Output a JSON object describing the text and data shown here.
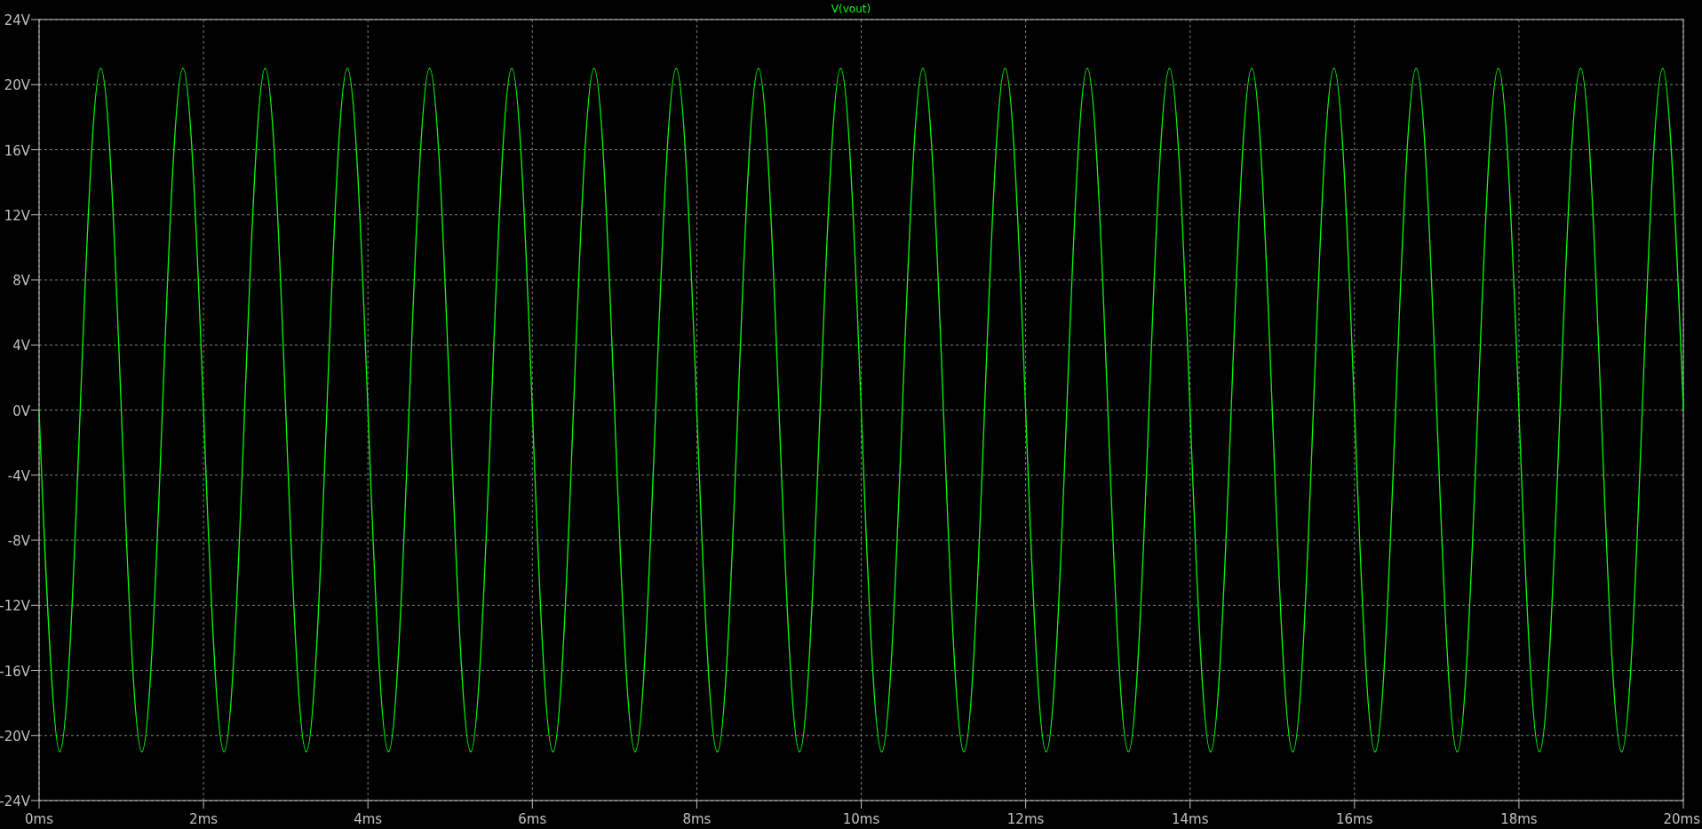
{
  "chart_data": {
    "type": "line",
    "grid": true,
    "xlim": [
      0,
      20
    ],
    "ylim": [
      -24,
      24
    ],
    "xticks": [
      {
        "value": 0,
        "label": "0ms"
      },
      {
        "value": 2,
        "label": "2ms"
      },
      {
        "value": 4,
        "label": "4ms"
      },
      {
        "value": 6,
        "label": "6ms"
      },
      {
        "value": 8,
        "label": "8ms"
      },
      {
        "value": 10,
        "label": "10ms"
      },
      {
        "value": 12,
        "label": "12ms"
      },
      {
        "value": 14,
        "label": "14ms"
      },
      {
        "value": 16,
        "label": "16ms"
      },
      {
        "value": 18,
        "label": "18ms"
      },
      {
        "value": 20,
        "label": "20ms"
      }
    ],
    "yticks": [
      {
        "value": 24,
        "label": "24V"
      },
      {
        "value": 20,
        "label": "20V"
      },
      {
        "value": 16,
        "label": "16V"
      },
      {
        "value": 12,
        "label": "12V"
      },
      {
        "value": 8,
        "label": "8V"
      },
      {
        "value": 4,
        "label": "4V"
      },
      {
        "value": 0,
        "label": "0V"
      },
      {
        "value": -4,
        "label": "-4V"
      },
      {
        "value": -8,
        "label": "-8V"
      },
      {
        "value": -12,
        "label": "-12V"
      },
      {
        "value": -16,
        "label": "-16V"
      },
      {
        "value": -20,
        "label": "-20V"
      },
      {
        "value": -24,
        "label": "-24V"
      }
    ],
    "x": [
      0,
      0.25,
      0.5,
      0.75,
      1,
      1.25,
      1.5,
      1.75,
      2,
      2.25,
      2.5,
      2.75,
      3,
      3.25,
      3.5,
      3.75,
      4,
      4.25,
      4.5,
      4.75,
      5,
      5.25,
      5.5,
      5.75,
      6,
      6.25,
      6.5,
      6.75,
      7,
      7.25,
      7.5,
      7.75,
      8,
      8.25,
      8.5,
      8.75,
      9,
      9.25,
      9.5,
      9.75,
      10,
      10.25,
      10.5,
      10.75,
      11,
      11.25,
      11.5,
      11.75,
      12,
      12.25,
      12.5,
      12.75,
      13,
      13.25,
      13.5,
      13.75,
      14,
      14.25,
      14.5,
      14.75,
      15,
      15.25,
      15.5,
      15.75,
      16,
      16.25,
      16.5,
      16.75,
      17,
      17.25,
      17.5,
      17.75,
      18,
      18.25,
      18.5,
      18.75,
      19,
      19.25,
      19.5,
      19.75,
      20
    ],
    "series": [
      {
        "name": "V(vout)",
        "color": "#00ff00",
        "values": [
          0,
          -21,
          0,
          21,
          0,
          -21,
          0,
          21,
          0,
          -21,
          0,
          21,
          0,
          -21,
          0,
          21,
          0,
          -21,
          0,
          21,
          0,
          -21,
          0,
          21,
          0,
          -21,
          0,
          21,
          0,
          -21,
          0,
          21,
          0,
          -21,
          0,
          21,
          0,
          -21,
          0,
          21,
          0,
          -21,
          0,
          21,
          0,
          -21,
          0,
          21,
          0,
          -21,
          0,
          21,
          0,
          -21,
          0,
          21,
          0,
          -21,
          0,
          21,
          0,
          -21,
          0,
          21,
          0,
          -21,
          0,
          21,
          0,
          -21,
          0,
          21,
          0,
          -21,
          0,
          21,
          0,
          -21,
          0,
          21,
          0
        ]
      }
    ]
  }
}
